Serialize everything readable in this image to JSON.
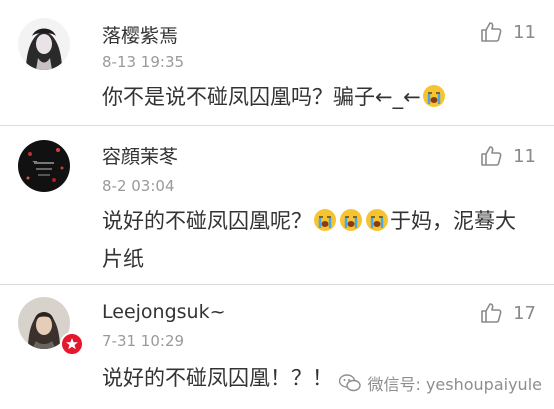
{
  "comments": [
    {
      "name": "落樱紫焉",
      "time": "8-13 19:35",
      "text": "你不是说不碰凤囚凰吗？骗子←_←",
      "likes": "11",
      "emoji": "crying-face"
    },
    {
      "name": "容顔茉苳",
      "time": "8-2 03:04",
      "text_a": "说好的不碰凤囚凰呢？",
      "text_b": "于妈，泥蓦大片纸",
      "likes": "11",
      "emoji": "crying-face"
    },
    {
      "name": "Leejongsuk~",
      "time": "7-31 10:29",
      "text": "说好的不碰凤囚凰！？！",
      "likes": "17"
    }
  ],
  "watermark": "微信号: yeshoupaiyule",
  "colors": {
    "separator": "#dcdcdc",
    "badge": "#e6162d"
  }
}
